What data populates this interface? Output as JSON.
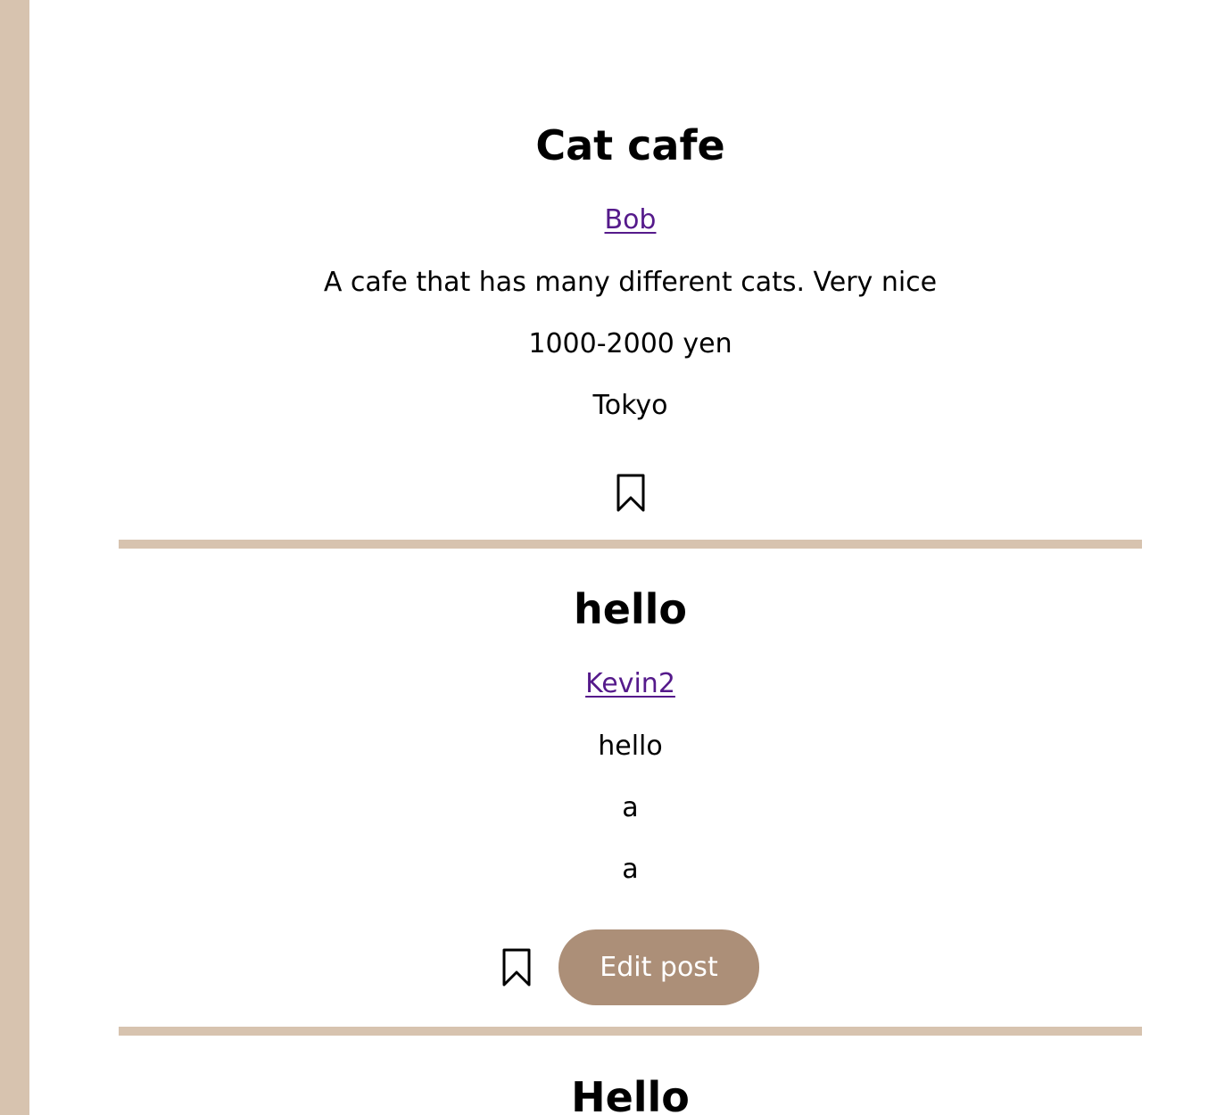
{
  "posts": [
    {
      "title": "Cat cafe",
      "author": "Bob",
      "description": "A cafe that has many different cats. Very nice",
      "price": "1000-2000 yen",
      "location": "Tokyo"
    },
    {
      "title": "hello",
      "author": "Kevin2",
      "description": "hello",
      "price": "a",
      "location": "a",
      "edit_label": "Edit post"
    },
    {
      "title": "Hello"
    }
  ],
  "icons": {
    "bookmark": "bookmark-icon"
  },
  "colors": {
    "strip": "#d7c3af",
    "divider": "#d7c3af",
    "button_bg": "#ac8f78",
    "link": "#551a8b"
  }
}
